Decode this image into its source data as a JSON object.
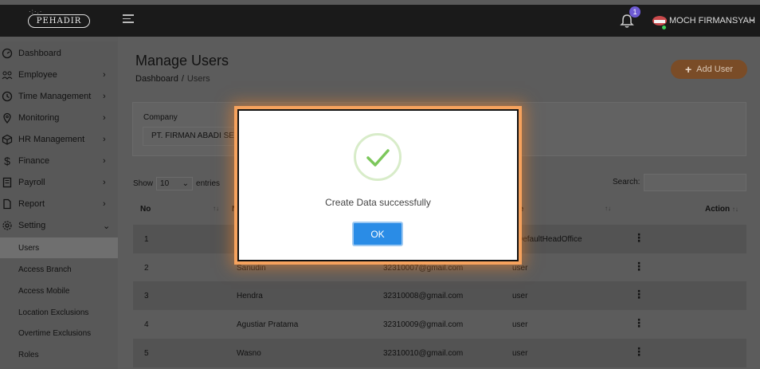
{
  "topbar": {
    "logo_text": "PEHADIR",
    "notification_count": "1",
    "username": "MOCH FIRMANSYAH"
  },
  "sidebar": {
    "items": [
      {
        "label": "Dashboard",
        "icon": "gauge-icon",
        "has_chevron": false
      },
      {
        "label": "Employee",
        "icon": "users-icon",
        "has_chevron": true
      },
      {
        "label": "Time Management",
        "icon": "clock-icon",
        "has_chevron": true
      },
      {
        "label": "Monitoring",
        "icon": "location-pin-icon",
        "has_chevron": true
      },
      {
        "label": "HR Management",
        "icon": "cube-icon",
        "has_chevron": true
      },
      {
        "label": "Finance",
        "icon": "dollar-icon",
        "has_chevron": true
      },
      {
        "label": "Payroll",
        "icon": "calculator-icon",
        "has_chevron": true
      },
      {
        "label": "Report",
        "icon": "file-icon",
        "has_chevron": true
      },
      {
        "label": "Setting",
        "icon": "gear-icon",
        "has_chevron": true,
        "expanded": true
      }
    ],
    "sub_items": [
      {
        "label": "Users",
        "active": true
      },
      {
        "label": "Access Branch"
      },
      {
        "label": "Access Mobile"
      },
      {
        "label": "Location Exclusions"
      },
      {
        "label": "Overtime Exclusions"
      },
      {
        "label": "Roles"
      }
    ]
  },
  "page": {
    "title": "Manage Users",
    "breadcrumb": {
      "root": "Dashboard",
      "separator": "/",
      "current": "Users"
    },
    "add_button": "Add User",
    "add_button_icon": "+"
  },
  "filter": {
    "company_label": "Company",
    "company_value": "PT. FIRMAN ABADI SENT"
  },
  "table_controls": {
    "show_label": "Show",
    "entries_value": "10",
    "entries_label": "entries",
    "search_label": "Search:"
  },
  "table": {
    "columns": [
      "No",
      "N",
      "",
      "le",
      "Action"
    ],
    "rows": [
      {
        "no": "1",
        "name": "",
        "email": "",
        "role": "DefaultHeadOffice"
      },
      {
        "no": "2",
        "name": "Sanudin",
        "email": "32310007@gmail.com",
        "role": "user"
      },
      {
        "no": "3",
        "name": "Hendra",
        "email": "32310008@gmail.com",
        "role": "user"
      },
      {
        "no": "4",
        "name": "Agustiar Pratama",
        "email": "32310009@gmail.com",
        "role": "user"
      },
      {
        "no": "5",
        "name": "Wasno",
        "email": "32310010@gmail.com",
        "role": "user"
      }
    ]
  },
  "modal": {
    "message": "Create Data successfully",
    "ok_label": "OK",
    "icon": "success-check-icon"
  },
  "colors": {
    "accent_orange": "#f08a2c",
    "ok_blue": "#2a8ce6",
    "success_green": "#7cc75b",
    "badge_purple": "#6e5bd4"
  }
}
